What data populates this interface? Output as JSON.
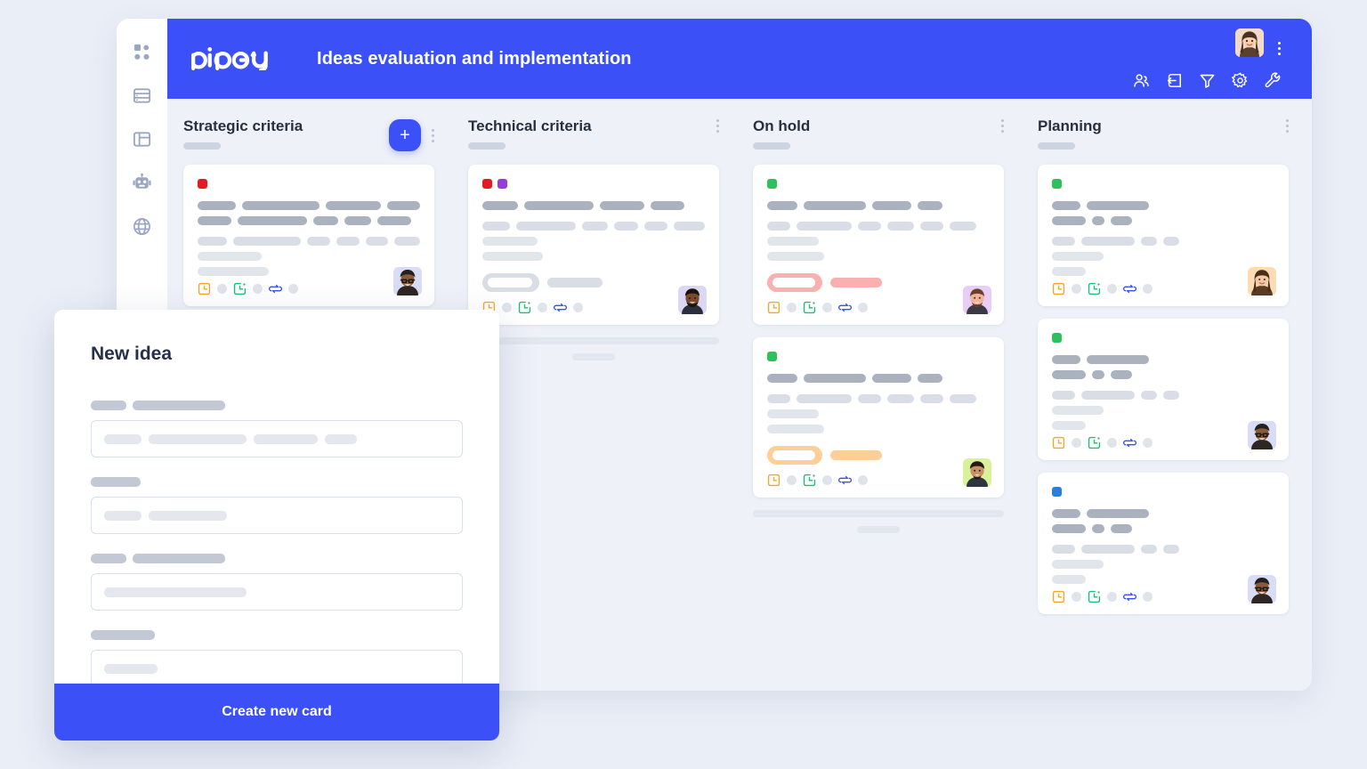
{
  "app": {
    "brand": "pipefy",
    "board_title": "Ideas evaluation and implementation",
    "accent_color": "#3b50f7",
    "canvas_color": "#eaeef7",
    "board_bg": "#eef1f8"
  },
  "sidebar": {
    "items": [
      {
        "icon": "grid-apps-icon",
        "label": "Apps"
      },
      {
        "icon": "database-icon",
        "label": "Database"
      },
      {
        "icon": "layout-panel-icon",
        "label": "Layout"
      },
      {
        "icon": "robot-icon",
        "label": "Automations"
      },
      {
        "icon": "globe-icon",
        "label": "Portal"
      }
    ]
  },
  "topbar": {
    "icons": [
      {
        "icon": "members-icon",
        "label": "Members"
      },
      {
        "icon": "inbox-import-icon",
        "label": "Inbox"
      },
      {
        "icon": "filter-icon",
        "label": "Filter"
      },
      {
        "icon": "gear-icon",
        "label": "Settings"
      },
      {
        "icon": "wrench-icon",
        "label": "Tools"
      }
    ],
    "avatar": "user-avatar",
    "kebab": "more-options-icon"
  },
  "columns": [
    {
      "title": "Strategic criteria",
      "has_add_button": true,
      "add_label": "+",
      "kebab": "more-options-icon",
      "cards": [
        {
          "dots": [
            "#e01b22"
          ],
          "avatar": "avatar-glasses-man",
          "title_widths": [
            44,
            88,
            62,
            38
          ],
          "meta_widths": [
            38,
            78,
            28,
            30,
            38
          ],
          "sub_widths": [
            38,
            88,
            30,
            30,
            28,
            34
          ],
          "line_widths": [
            72,
            80
          ],
          "badge": null,
          "foot_icons": [
            "clock-icon",
            "checklist-icon",
            "connection-icon"
          ]
        }
      ],
      "load_more": false
    },
    {
      "title": "Technical criteria",
      "has_add_button": false,
      "kebab": "more-options-icon",
      "cards": [
        {
          "dots": [
            "#e01b22",
            "#9b3ad6"
          ],
          "avatar": "avatar-bearded-man",
          "title_widths": [
            40,
            78,
            50,
            38
          ],
          "meta_widths": [
            0
          ],
          "sub_widths": [
            32,
            70,
            30,
            28,
            28,
            36
          ],
          "line_widths": [
            62,
            68
          ],
          "badge": {
            "type": "outline",
            "color": "#d9dde5",
            "inner_width": 50,
            "solid_width": 62
          },
          "foot_icons": [
            "clock-icon",
            "checklist-icon",
            "connection-icon"
          ]
        }
      ],
      "load_more": true
    },
    {
      "title": "On hold",
      "has_add_button": false,
      "kebab": "more-options-icon",
      "cards": [
        {
          "dots": [
            "#2fbf5c"
          ],
          "avatar": "avatar-pink-man",
          "title_widths": [
            34,
            70,
            44,
            28
          ],
          "meta_widths": [
            0
          ],
          "sub_widths": [
            26,
            62,
            26,
            30,
            26,
            30
          ],
          "line_widths": [
            58,
            64
          ],
          "badge": {
            "type": "outline",
            "color": "#f9b0ae",
            "inner_width": 48,
            "solid_width": 58
          },
          "foot_icons": [
            "clock-icon",
            "checklist-icon",
            "connection-icon"
          ]
        },
        {
          "dots": [
            "#2fbf5c"
          ],
          "avatar": "avatar-green-man",
          "title_widths": [
            34,
            70,
            44,
            28
          ],
          "meta_widths": [
            0
          ],
          "sub_widths": [
            26,
            62,
            26,
            30,
            26,
            30
          ],
          "line_widths": [
            58,
            64
          ],
          "badge": {
            "type": "outline",
            "color": "#fbcf95",
            "inner_width": 48,
            "solid_width": 58
          },
          "foot_icons": [
            "clock-icon",
            "checklist-icon",
            "connection-icon"
          ]
        }
      ],
      "load_more": true
    },
    {
      "title": "Planning",
      "has_add_button": false,
      "kebab": "more-options-icon",
      "cards": [
        {
          "dots": [
            "#2fbf5c"
          ],
          "avatar": "avatar-woman",
          "title_widths": [
            32,
            70
          ],
          "meta_widths": [
            38,
            14,
            24
          ],
          "sub_widths": [
            26,
            60,
            18,
            18
          ],
          "line_widths": [
            58,
            38
          ],
          "badge": null,
          "foot_icons": [
            "clock-icon",
            "checklist-icon",
            "connection-icon"
          ]
        },
        {
          "dots": [
            "#2fbf5c"
          ],
          "avatar": "avatar-glasses-man",
          "title_widths": [
            32,
            70
          ],
          "meta_widths": [
            38,
            14,
            24
          ],
          "sub_widths": [
            26,
            60,
            18,
            18
          ],
          "line_widths": [
            58,
            38
          ],
          "badge": null,
          "foot_icons": [
            "clock-icon",
            "checklist-icon",
            "connection-icon"
          ]
        },
        {
          "dots": [
            "#2b7fd4"
          ],
          "avatar": "avatar-glasses-man",
          "title_widths": [
            32,
            70
          ],
          "meta_widths": [
            38,
            14,
            24
          ],
          "sub_widths": [
            26,
            60,
            18,
            18
          ],
          "line_widths": [
            58,
            38
          ],
          "badge": null,
          "foot_icons": [
            "clock-icon",
            "checklist-icon",
            "connection-icon"
          ]
        }
      ],
      "load_more": false
    }
  ],
  "modal": {
    "title": "New idea",
    "submit_label": "Create new card",
    "fields": [
      {
        "label_widths": [
          40,
          104
        ],
        "input_widths": [
          42,
          110,
          72,
          36
        ]
      },
      {
        "label_widths": [
          56
        ],
        "input_widths": [
          42,
          88
        ]
      },
      {
        "label_widths": [
          40,
          104
        ],
        "input_widths": [
          160
        ]
      },
      {
        "label_widths": [
          72
        ],
        "input_widths": [
          60
        ]
      }
    ]
  }
}
